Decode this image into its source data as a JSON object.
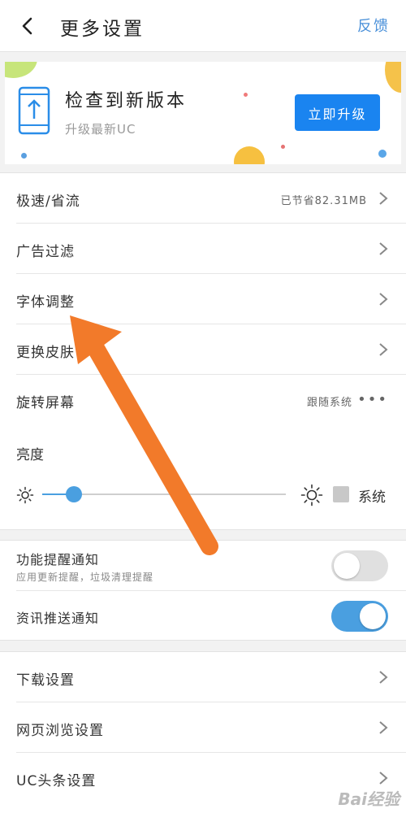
{
  "header": {
    "title": "更多设置",
    "feedback": "反馈"
  },
  "banner": {
    "title": "检查到新版本",
    "subtitle": "升级最新UC",
    "button": "立即升级"
  },
  "settings": [
    {
      "label": "极速/省流",
      "value": "已节省82.31MB"
    },
    {
      "label": "广告过滤"
    },
    {
      "label": "字体调整"
    },
    {
      "label": "更换皮肤"
    },
    {
      "label": "旋转屏幕",
      "value": "跟随系统"
    }
  ],
  "brightness": {
    "label": "亮度",
    "level": 0.13,
    "system_label": "系统"
  },
  "notifications": [
    {
      "label": "功能提醒通知",
      "sub": "应用更新提醒，垃圾清理提醒",
      "on": false
    },
    {
      "label": "资讯推送通知",
      "on": true
    }
  ],
  "more": [
    {
      "label": "下载设置"
    },
    {
      "label": "网页浏览设置"
    },
    {
      "label": "UC头条设置"
    }
  ],
  "colors": {
    "accent": "#1a84f0",
    "switch_on": "#4a9fe0",
    "switch_off": "#e0e0e0",
    "arrow": "#f27a2a"
  },
  "watermark": "Bai经验"
}
